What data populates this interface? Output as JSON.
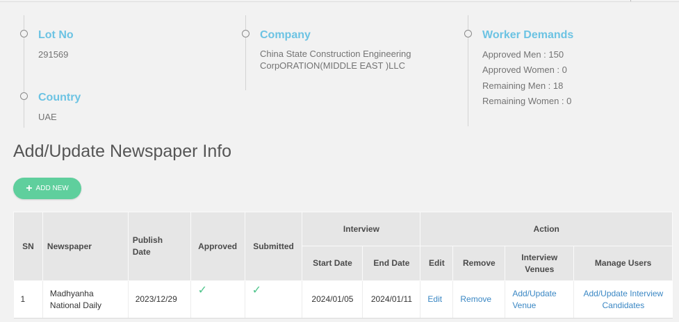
{
  "summary": {
    "lot": {
      "title": "Lot No",
      "value": "291569"
    },
    "country": {
      "title": "Country",
      "value": "UAE"
    },
    "company": {
      "title": "Company",
      "value_line1": "China State Construction Engineering",
      "value_line2": "CorpORATION(MIDDLE EAST )LLC"
    },
    "demands": {
      "title": "Worker Demands",
      "approved_men": "Approved Men : 150",
      "approved_women": "Approved Women : 0",
      "remaining_men": "Remaining Men : 18",
      "remaining_women": "Remaining Women : 0"
    }
  },
  "section_title": "Add/Update Newspaper Info",
  "add_button": {
    "icon": "plus-icon",
    "label": "ADD NEW"
  },
  "table": {
    "headers": {
      "sn": "SN",
      "newspaper": "Newspaper",
      "publish_date_1": "Publish",
      "publish_date_2": "Date",
      "approved": "Approved",
      "submitted": "Submitted",
      "interview": "Interview",
      "action": "Action",
      "start_date": "Start Date",
      "end_date": "End Date",
      "edit": "Edit",
      "remove": "Remove",
      "venues_1": "Interview",
      "venues_2": "Venues",
      "manage_users": "Manage Users"
    },
    "rows": [
      {
        "sn": "1",
        "newspaper_1": "Madhyanha",
        "newspaper_2": "National Daily",
        "publish_date": "2023/12/29",
        "approved_icon": "check-icon",
        "submitted_icon": "check-icon",
        "start_date": "2024/01/05",
        "end_date": "2024/01/11",
        "edit": "Edit",
        "remove": "Remove",
        "venue_1": "Add/Update",
        "venue_2": "Venue",
        "candidates_1": "Add/Update Interview",
        "candidates_2": "Candidates"
      }
    ]
  },
  "colors": {
    "accent": "#6cc3e3",
    "button": "#5fcf9d",
    "link": "#3a87c4",
    "check": "#4cc48a"
  }
}
